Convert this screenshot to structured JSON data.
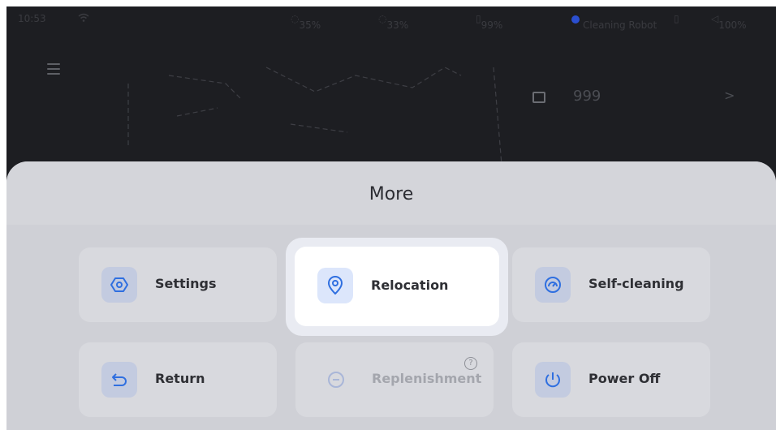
{
  "status_bar": {
    "time": "10:53",
    "wifi_icon": "wifi-icon",
    "stat1": "35%",
    "stat2": "33%",
    "stat3": "99%",
    "badge": "Cleaning Robot",
    "volume": "100%"
  },
  "background": {
    "counter_value": "999",
    "chevron": ">"
  },
  "sheet": {
    "title": "More",
    "tiles": [
      {
        "label": "Settings",
        "icon": "settings-icon",
        "enabled": true
      },
      {
        "label": "Relocation",
        "icon": "location-pin-icon",
        "enabled": true,
        "focused": true
      },
      {
        "label": "Self-cleaning",
        "icon": "self-cleaning-icon",
        "enabled": true
      },
      {
        "label": "Return",
        "icon": "return-icon",
        "enabled": true
      },
      {
        "label": "Replenishment",
        "icon": "replenishment-icon",
        "enabled": false,
        "help": "?"
      },
      {
        "label": "Power Off",
        "icon": "power-icon",
        "enabled": true
      }
    ]
  },
  "colors": {
    "accent": "#2f6fe0",
    "sheet_bg": "#d6d7dc",
    "background_screen": "#1d1e22"
  }
}
